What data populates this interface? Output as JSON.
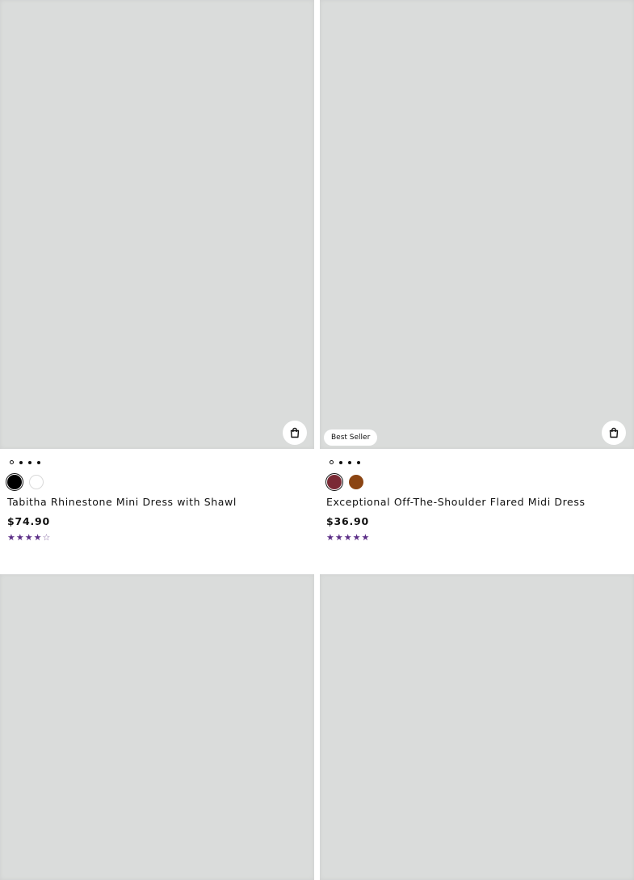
{
  "products": [
    {
      "title": "Tabitha Rhinestone Mini Dress with Shawl",
      "price": "$74.90",
      "badge": "",
      "rating": 4,
      "rating_max": 5,
      "image_count": 4,
      "active_image": 1,
      "swatches": [
        {
          "name": "Black",
          "color": "#000000",
          "selected": true
        },
        {
          "name": "White",
          "color": "#ffffff",
          "selected": false
        }
      ]
    },
    {
      "title": "Exceptional Off-The-Shoulder Flared Midi Dress",
      "price": "$36.90",
      "badge": "Best Seller",
      "rating": 5,
      "rating_max": 5,
      "image_count": 4,
      "active_image": 1,
      "swatches": [
        {
          "name": "Wine",
          "color": "#7a2a35",
          "selected": true
        },
        {
          "name": "Rust",
          "color": "#8b4513",
          "selected": false
        }
      ]
    },
    {
      "title": "",
      "price": "",
      "badge": "",
      "swatches": []
    },
    {
      "title": "",
      "price": "",
      "badge": "",
      "swatches": []
    }
  ],
  "colors": {
    "image_placeholder": "#dadcdb",
    "star": "#5b2d86",
    "text": "#111111"
  },
  "icons": {
    "quick_add": "shopping-bag-icon",
    "star_full": "★",
    "star_empty": "☆"
  }
}
